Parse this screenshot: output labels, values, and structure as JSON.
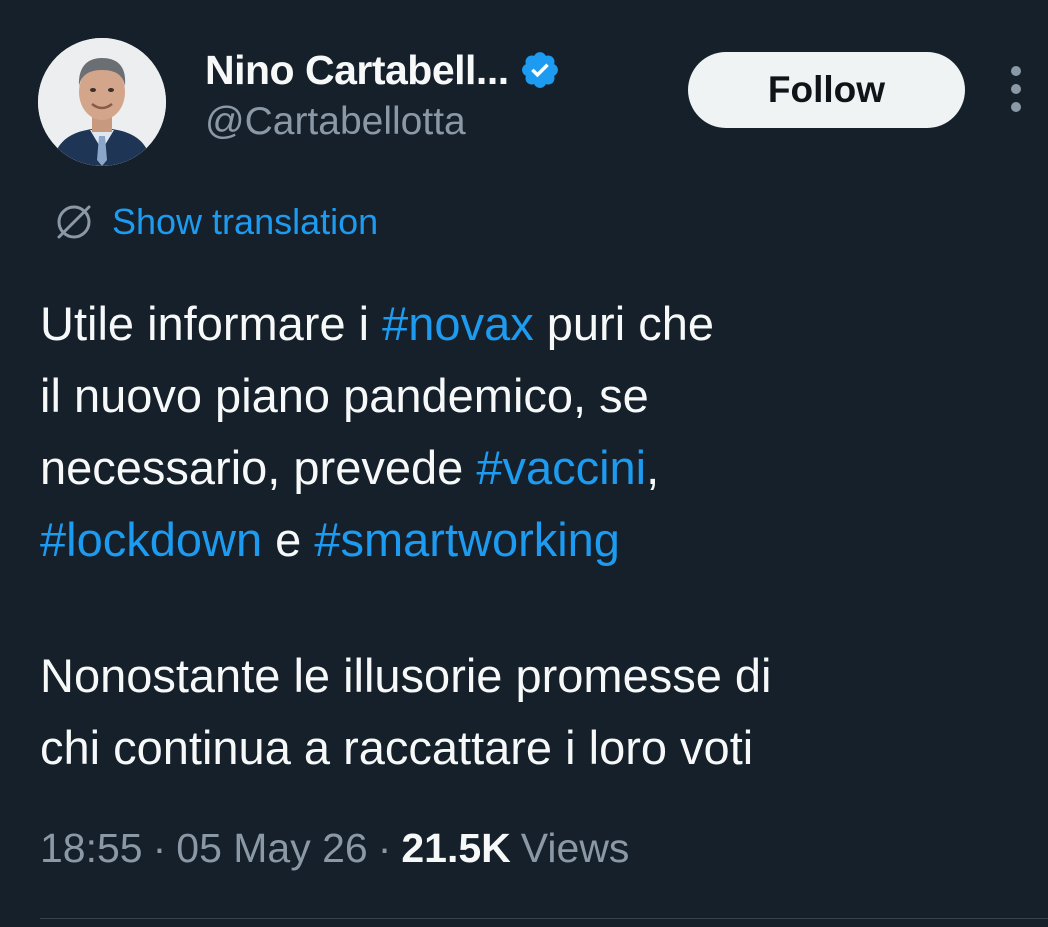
{
  "author": {
    "display_name": "Nino Cartabell...",
    "handle": "@Cartabellotta",
    "verified": true,
    "verified_icon": "verified-badge-icon"
  },
  "actions": {
    "follow_label": "Follow",
    "more_icon": "more-vertical-icon"
  },
  "translation": {
    "icon": "globe-icon",
    "label": "Show translation"
  },
  "tweet": {
    "line1_a": "Utile informare i ",
    "line1_tag": "#novax",
    "line1_b": " puri che",
    "line2": "il nuovo piano pandemico, se",
    "line3_a": "necessario, prevede ",
    "line3_tag": "#vaccini",
    "line3_b": ",",
    "line4_tag1": "#lockdown",
    "line4_mid": " e ",
    "line4_tag2": "#smartworking",
    "line5": "Nonostante le illusorie promesse di",
    "line6": "chi continua a raccattare i loro voti"
  },
  "meta": {
    "time": "18:55",
    "separator": "·",
    "date": "05 May 26",
    "views_count": "21.5K",
    "views_label": "Views"
  },
  "colors": {
    "background": "#15202b",
    "accent": "#1d9bf0",
    "secondary_text": "#8b98a5",
    "primary_text": "#f7f9f9"
  }
}
